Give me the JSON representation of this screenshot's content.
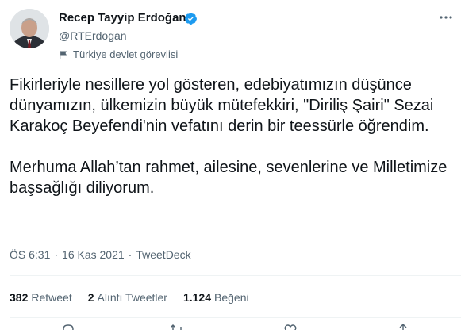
{
  "author": {
    "display_name": "Recep Tayyip Erdoğan",
    "handle": "@RTErdogan",
    "label": "Türkiye devlet görevlisi",
    "verified": true,
    "verified_color": "#1d9bf0"
  },
  "tweet": {
    "paragraphs": [
      "Fikirleriyle nesillere yol gösteren, edebiyatımızın düşünce dünyamızın, ülkemizin büyük mütefekkiri, \"Diriliş Şairi\" Sezai Karakoç Beyefendi'nin vefatını derin bir teessürle öğrendim.",
      "Merhuma Allah’tan rahmet, ailesine, sevenlerine ve Milletimize başsağlığı diliyorum."
    ],
    "time": "ÖS 6:31",
    "date": "16 Kas 2021",
    "source": "TweetDeck",
    "separator": "·"
  },
  "stats": {
    "retweets_count": "382",
    "retweets_label": "Retweet",
    "quotes_count": "2",
    "quotes_label": "Alıntı Tweetler",
    "likes_count": "1.124",
    "likes_label": "Beğeni"
  },
  "icons": {
    "more": "more-icon",
    "flag": "flag-icon",
    "reply": "reply-icon",
    "retweet": "retweet-icon",
    "like": "heart-icon",
    "share": "share-icon"
  },
  "colors": {
    "text": "#0f1419",
    "secondary": "#536471",
    "divider": "#eff3f4",
    "accent": "#1d9bf0"
  }
}
